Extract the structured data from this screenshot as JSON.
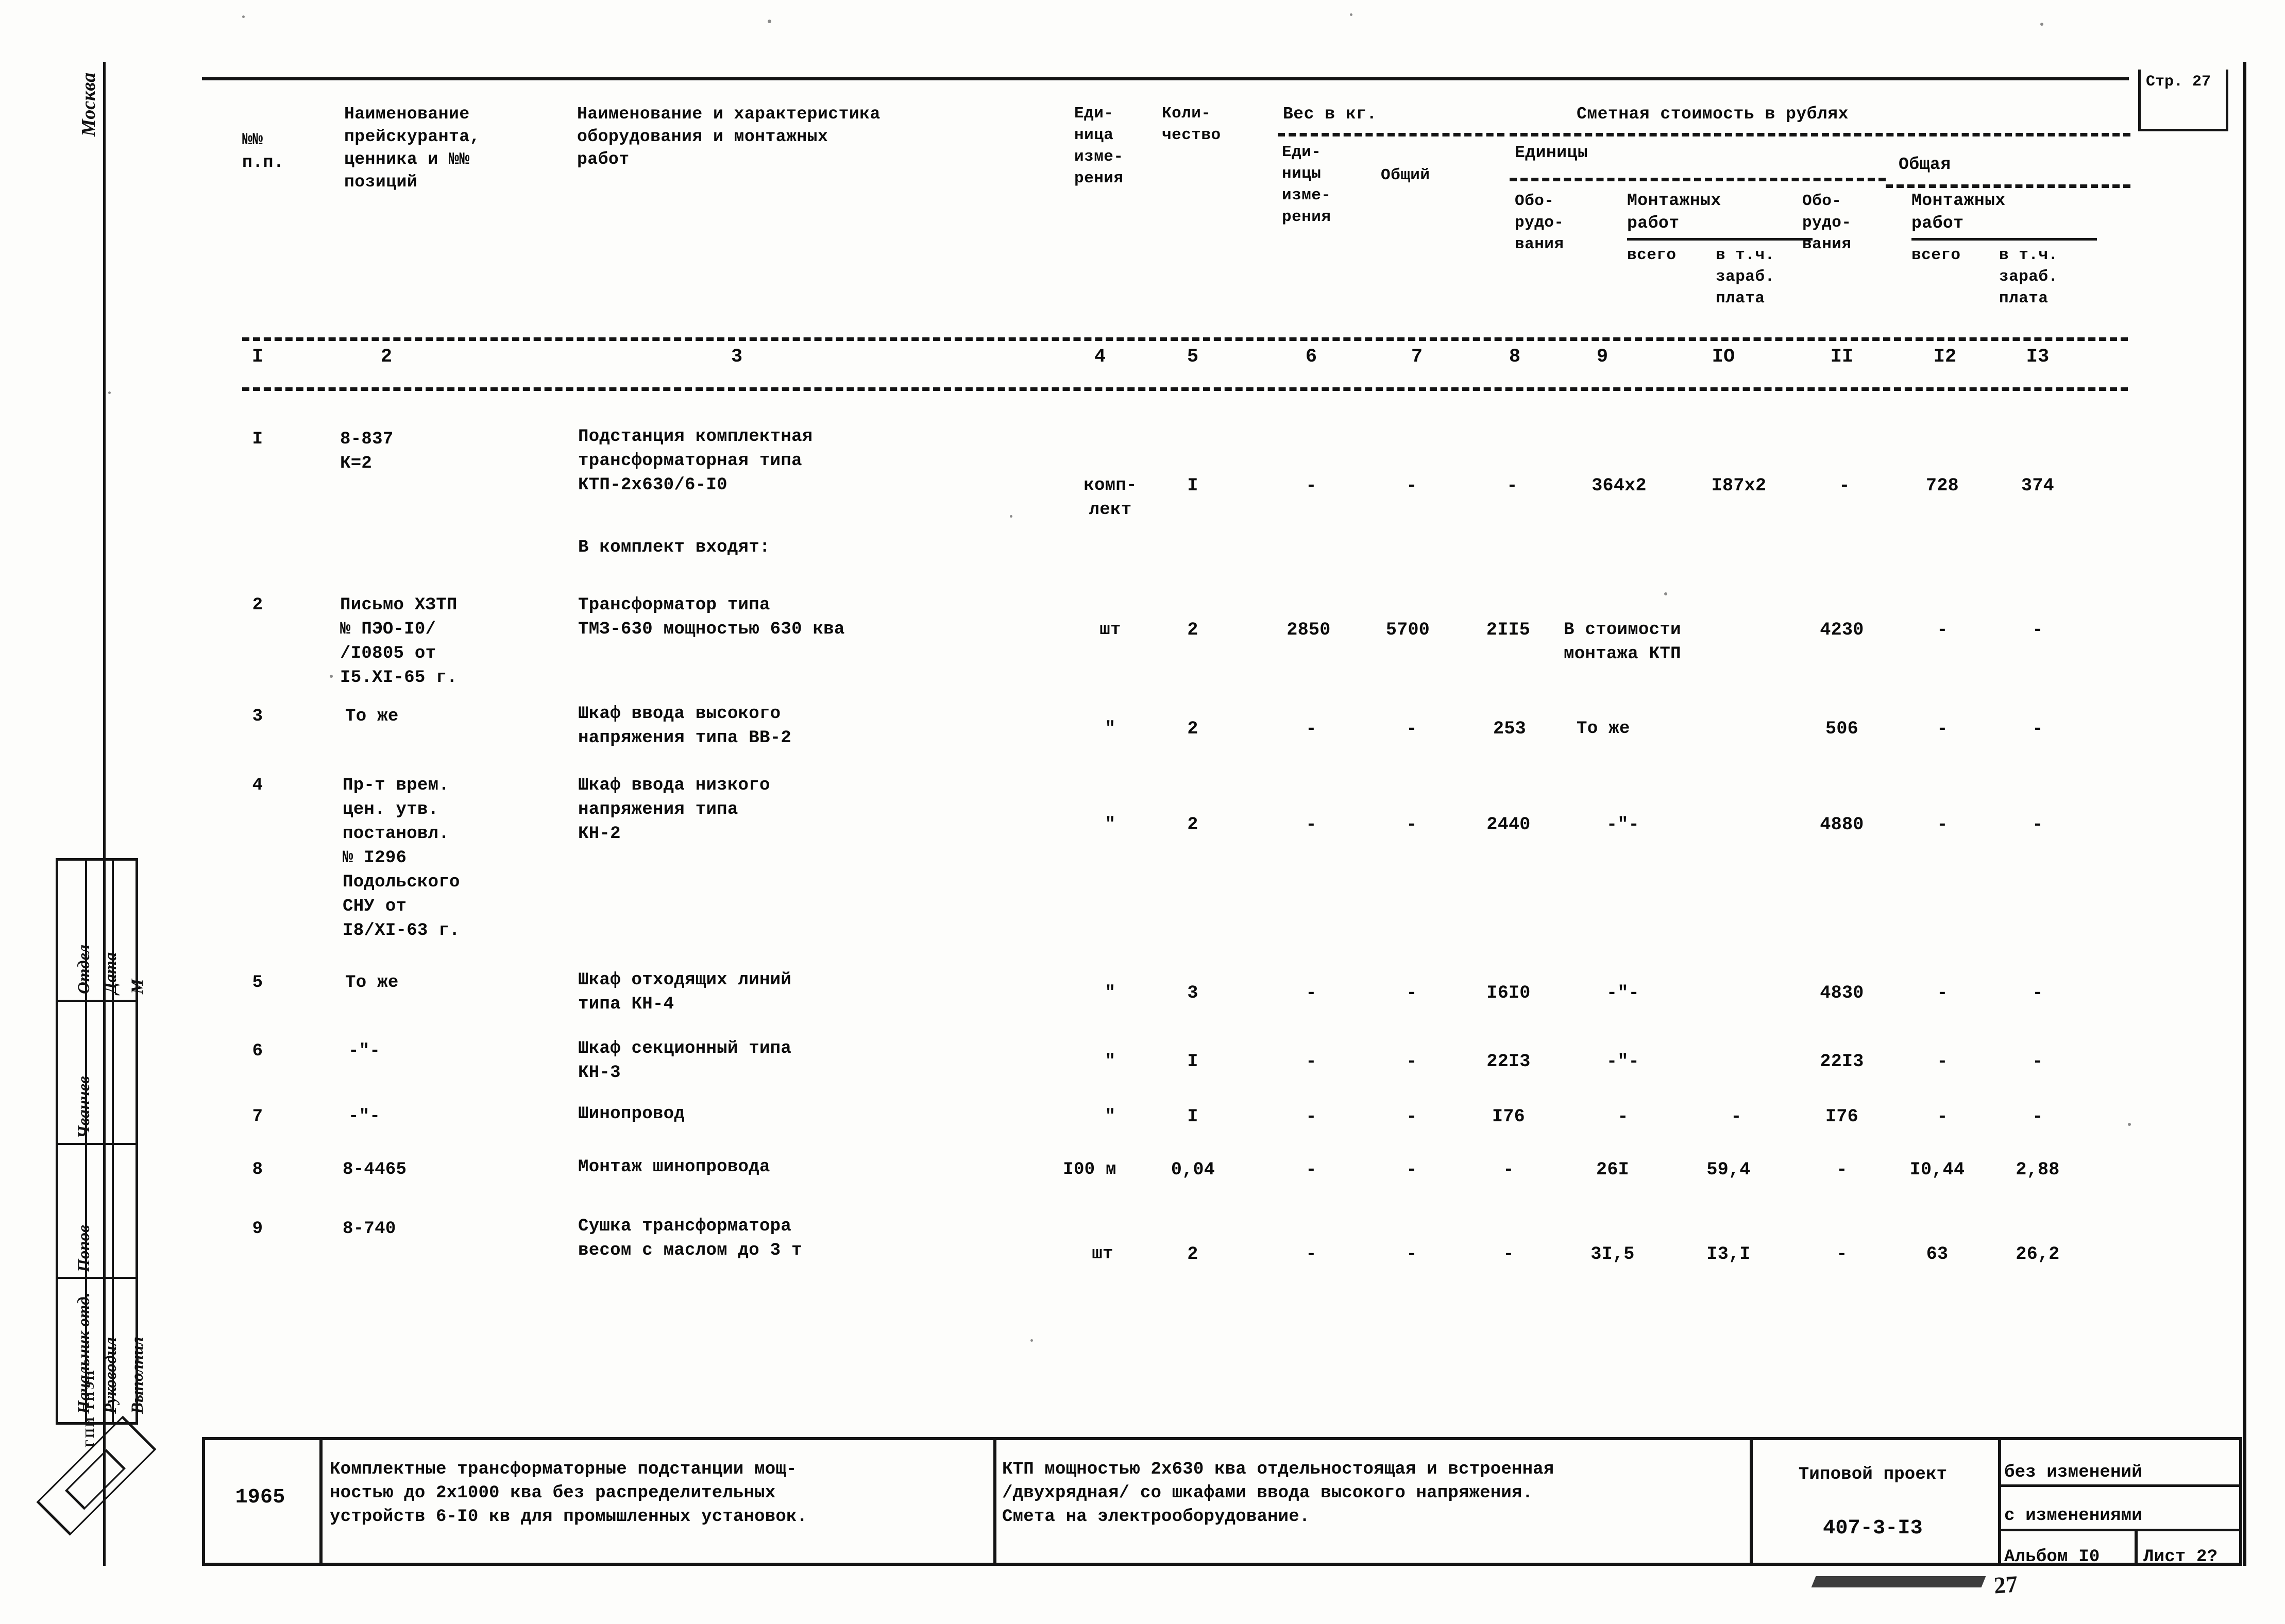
{
  "document": {
    "page_label": "Стр.\n27",
    "year": "1965",
    "project_label": "Типовой проект",
    "project_number": "407-3-I3",
    "album": "Альбом I0",
    "sheet": "Лист 2?",
    "no_changes": "без изменений",
    "with_changes": "с изменениями",
    "title_left": "Комплектные трансформаторные подстанции мощ-\nностью до 2х1000 ква без распределительных\nустройств 6-I0 кв для промышленных установок.",
    "title_center": "КТП мощностью 2х630 ква отдельностоящая и встроенная\n/двухрядная/ со шкафами ввода высокого напряжения.\nСмета на электрооборудование.",
    "logo_letters": "ГПИ ТПЭП",
    "city": "Москва",
    "bottom_smudge_text": "27"
  },
  "stamp_block": {
    "rows": [
      {
        "role": "Начальник отд.",
        "signature": "Отдел",
        "date_col": "Дата",
        "scale_col": "М"
      },
      {
        "role": "Руководил",
        "signature": "Чванчев",
        "date_col": "",
        "scale_col": ""
      },
      {
        "role": "Выполнил",
        "signature": "Попов",
        "date_col": "",
        "scale_col": ""
      }
    ],
    "labels": {
      "date": "Дата",
      "scale": "М",
      "dept": "Отдел",
      "chief": "Начальник отд.",
      "supervisor": "Руководил",
      "executor": "Выполнил"
    }
  },
  "table": {
    "headers": {
      "col1": "№№\nп.п.",
      "col2": "Наименование\nпрейскуранта,\nценника и №№\nпозиций",
      "col3": "Наименование и характеристика\nоборудования и монтажных\nработ",
      "col4": "Еди-\nница\nизме-\nрения",
      "col5": "Коли-\nчество",
      "weight_group": "Вес в кг.",
      "col6": "Еди-\nницы\nизме-\nрения",
      "col7": "Общий",
      "cost_group": "Сметная стоимость в рублях",
      "unit_group": "Единицы",
      "total_group": "Общая",
      "col8": "Обо-\nрудо-\nвания",
      "col9_10_group": "Монтажных\nработ",
      "col9": "всего",
      "col10": "в т.ч.\nзараб.\nплата",
      "col11": "Обо-\nрудо-\nвания",
      "col12_13_group": "Монтажных\nработ",
      "col12": "всего",
      "col13": "в т.ч.\nзараб.\nплата"
    },
    "column_numbers": [
      "I",
      "2",
      "3",
      "4",
      "5",
      "6",
      "7",
      "8",
      "9",
      "IO",
      "II",
      "I2",
      "I3"
    ],
    "rows": [
      {
        "no": "I",
        "source": "8-837\nК=2",
        "name": "Подстанция комплектная\nтрансформаторная типа\nКТП-2х630/6-I0",
        "unit": "комп-\nлект",
        "qty": "I",
        "w_unit": "-",
        "w_total": "-",
        "c_equip_unit": "-",
        "c_mont_all": "364х2",
        "c_mont_wage": "I87х2",
        "c_equip_total": "-",
        "t_mont_all": "728",
        "t_mont_wage": "374"
      },
      {
        "no": "",
        "source": "",
        "name": "В комплект входят:",
        "unit": "",
        "qty": "",
        "w_unit": "",
        "w_total": "",
        "c_equip_unit": "",
        "c_mont_all": "",
        "c_mont_wage": "",
        "c_equip_total": "",
        "t_mont_all": "",
        "t_mont_wage": ""
      },
      {
        "no": "2",
        "source": "Письмо ХЗТП\n№ ПЭО-I0/\n/I0805 от\nI5.XI-65 г.",
        "name": "Трансформатор типа\nТМЗ-630 мощностью 630 ква",
        "unit": "шт",
        "qty": "2",
        "w_unit": "2850",
        "w_total": "5700",
        "c_equip_unit": "2II5",
        "c_mont_all": "В стоимости\nмонтажа КТП",
        "c_mont_wage": "",
        "c_equip_total": "4230",
        "t_mont_all": "-",
        "t_mont_wage": "-"
      },
      {
        "no": "3",
        "source": "То же",
        "name": "Шкаф ввода высокого\nнапряжения типа ВВ-2",
        "unit": "\"",
        "qty": "2",
        "w_unit": "-",
        "w_total": "-",
        "c_equip_unit": "253",
        "c_mont_all": "То же",
        "c_mont_wage": "",
        "c_equip_total": "506",
        "t_mont_all": "-",
        "t_mont_wage": "-"
      },
      {
        "no": "4",
        "source": "Пр-т врем.\nцен. утв.\nпостановл.\n№ I296\nПодольского\nСНУ от\nI8/XI-63 г.",
        "name": "Шкаф ввода низкого\nнапряжения типа\nКН-2",
        "unit": "\"",
        "qty": "2",
        "w_unit": "-",
        "w_total": "-",
        "c_equip_unit": "2440",
        "c_mont_all": "-\"-",
        "c_mont_wage": "",
        "c_equip_total": "4880",
        "t_mont_all": "-",
        "t_mont_wage": "-"
      },
      {
        "no": "5",
        "source": "То же",
        "name": "Шкаф отходящих линий\nтипа КН-4",
        "unit": "\"",
        "qty": "3",
        "w_unit": "-",
        "w_total": "-",
        "c_equip_unit": "I6I0",
        "c_mont_all": "-\"-",
        "c_mont_wage": "",
        "c_equip_total": "4830",
        "t_mont_all": "-",
        "t_mont_wage": "-"
      },
      {
        "no": "6",
        "source": "-\"-",
        "name": "Шкаф секционный типа\nКН-3",
        "unit": "\"",
        "qty": "I",
        "w_unit": "-",
        "w_total": "-",
        "c_equip_unit": "22I3",
        "c_mont_all": "-\"-",
        "c_mont_wage": "",
        "c_equip_total": "22I3",
        "t_mont_all": "-",
        "t_mont_wage": "-"
      },
      {
        "no": "7",
        "source": "-\"-",
        "name": "Шинопровод",
        "unit": "\"",
        "qty": "I",
        "w_unit": "-",
        "w_total": "-",
        "c_equip_unit": "I76",
        "c_mont_all": "-",
        "c_mont_wage": "-",
        "c_equip_total": "I76",
        "t_mont_all": "-",
        "t_mont_wage": "-"
      },
      {
        "no": "8",
        "source": "8-4465",
        "name": "Монтаж шинопровода",
        "unit": "I00 м",
        "qty": "0,04",
        "w_unit": "-",
        "w_total": "-",
        "c_equip_unit": "-",
        "c_mont_all": "26I",
        "c_mont_wage": "59,4",
        "c_equip_total": "-",
        "t_mont_all": "I0,44",
        "t_mont_wage": "2,88"
      },
      {
        "no": "9",
        "source": "8-740",
        "name": "Сушка трансформатора\nвесом с маслом до 3 т",
        "unit": "шт",
        "qty": "2",
        "w_unit": "-",
        "w_total": "-",
        "c_equip_unit": "-",
        "c_mont_all": "3I,5",
        "c_mont_wage": "I3,I",
        "c_equip_total": "-",
        "t_mont_all": "63",
        "t_mont_wage": "26,2"
      }
    ]
  }
}
